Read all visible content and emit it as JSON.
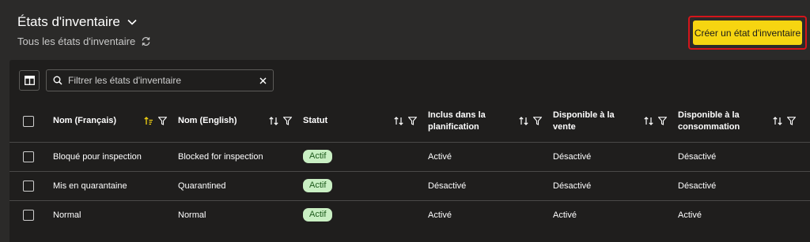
{
  "header": {
    "title": "États d'inventaire",
    "subtitle": "Tous les états d'inventaire"
  },
  "actions": {
    "create_label": "Créer un état d'inventaire"
  },
  "search": {
    "placeholder": "Filtrer les états d'inventaire"
  },
  "table": {
    "columns": [
      {
        "label": "Nom (Français)",
        "sort": "ascending"
      },
      {
        "label": "Nom (English)",
        "sort": "none"
      },
      {
        "label": "Statut",
        "sort": "none"
      },
      {
        "label": "Inclus dans la planification",
        "sort": "none"
      },
      {
        "label": "Disponible à la vente",
        "sort": "none"
      },
      {
        "label": "Disponible à la consommation",
        "sort": "none"
      }
    ],
    "rows": [
      {
        "nom_fr": "Bloqué pour inspection",
        "nom_en": "Blocked for inspection",
        "statut": "Actif",
        "planification": "Activé",
        "vente": "Désactivé",
        "consommation": "Désactivé"
      },
      {
        "nom_fr": "Mis en quarantaine",
        "nom_en": "Quarantined",
        "statut": "Actif",
        "planification": "Désactivé",
        "vente": "Désactivé",
        "consommation": "Désactivé"
      },
      {
        "nom_fr": "Normal",
        "nom_en": "Normal",
        "statut": "Actif",
        "planification": "Activé",
        "vente": "Activé",
        "consommation": "Activé"
      }
    ]
  },
  "colors": {
    "background": "#2b2a29",
    "panel": "#1f1e1d",
    "accent": "#f6d511",
    "highlight_border": "#d4151b",
    "badge_bg": "#c9efc3",
    "badge_text": "#1d5a1b",
    "sort_active": "#f6d511"
  },
  "icons": [
    "chevron-down-icon",
    "refresh-icon",
    "columns-icon",
    "search-icon",
    "clear-icon",
    "sort-icon",
    "filter-icon"
  ]
}
